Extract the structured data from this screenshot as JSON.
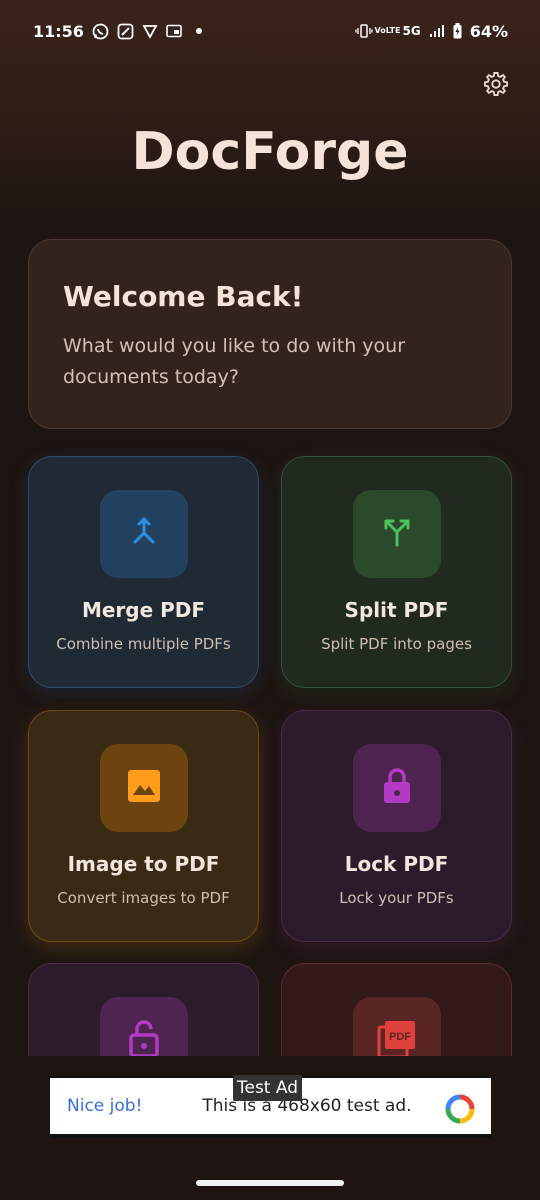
{
  "status_bar": {
    "time": "11:56",
    "network": "5G",
    "volte": "VoLTE",
    "battery": "64%",
    "icons": [
      "whatsapp-icon",
      "gallery-app-icon",
      "vpn-icon",
      "cast-icon",
      "notification-dot-icon",
      "vibrate-icon",
      "signal-icon",
      "battery-charging-icon"
    ]
  },
  "header": {
    "app_title": "DocForge",
    "settings_icon": "gear-icon"
  },
  "welcome": {
    "title": "Welcome Back!",
    "subtitle": "What would you like to do with your documents today?"
  },
  "tools": [
    {
      "title": "Merge PDF",
      "subtitle": "Combine multiple PDFs",
      "icon": "merge-icon",
      "accent": "#2f8fe0"
    },
    {
      "title": "Split PDF",
      "subtitle": "Split PDF into pages",
      "icon": "split-icon",
      "accent": "#4cc25a"
    },
    {
      "title": "Image to PDF",
      "subtitle": "Convert images to PDF",
      "icon": "image-icon",
      "accent": "#ff9c1a"
    },
    {
      "title": "Lock PDF",
      "subtitle": "Lock your PDFs",
      "icon": "lock-icon",
      "accent": "#b23bc6"
    },
    {
      "title": "",
      "subtitle": "",
      "icon": "unlock-icon",
      "accent": "#b23bc6"
    },
    {
      "title": "",
      "subtitle": "",
      "icon": "pdf-file-icon",
      "accent": "#e0413b"
    }
  ],
  "ad": {
    "label": "Test Ad",
    "left_text": "Nice job!",
    "body_text": "This is a 468x60 test ad.",
    "logo": "ad-logo-icon"
  }
}
